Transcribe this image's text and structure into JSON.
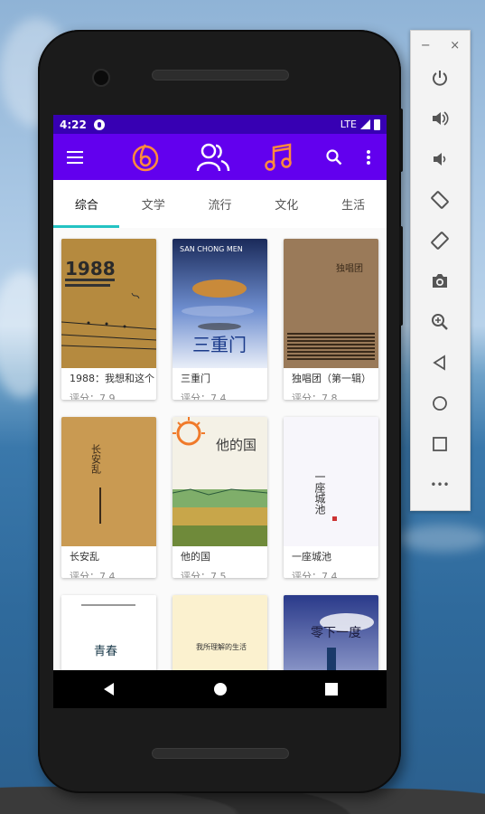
{
  "status_bar": {
    "time": "4:22",
    "network": "LTE"
  },
  "tabs": [
    {
      "label": "综合"
    },
    {
      "label": "文学"
    },
    {
      "label": "流行"
    },
    {
      "label": "文化"
    },
    {
      "label": "生活"
    }
  ],
  "books": [
    {
      "title": "1988：我想和这个",
      "rating": "评分：7.9",
      "cover_text": "1988"
    },
    {
      "title": "三重门",
      "rating": "评分：7.4",
      "cover_text": "三重门"
    },
    {
      "title": "独唱团（第一辑）",
      "rating": "评分：7.8",
      "cover_text": "独唱团"
    },
    {
      "title": "长安乱",
      "rating": "评分：7.4",
      "cover_text": "长安乱"
    },
    {
      "title": "他的国",
      "rating": "评分：7.5",
      "cover_text": "他的国"
    },
    {
      "title": "一座城池",
      "rating": "评分：7.4",
      "cover_text": "一座城池"
    },
    {
      "title": "",
      "rating": "",
      "cover_text": "青春"
    },
    {
      "title": "",
      "rating": "",
      "cover_text": "我所理解的生活"
    },
    {
      "title": "",
      "rating": "",
      "cover_text": "零下一度"
    }
  ],
  "colors": {
    "primary": "#6200ee",
    "status": "#3700b3",
    "accent": "#24c3c3",
    "icon_orange": "#ff8a3d"
  },
  "emulator": {
    "minimize": "−",
    "close": "×",
    "more": "•••"
  }
}
